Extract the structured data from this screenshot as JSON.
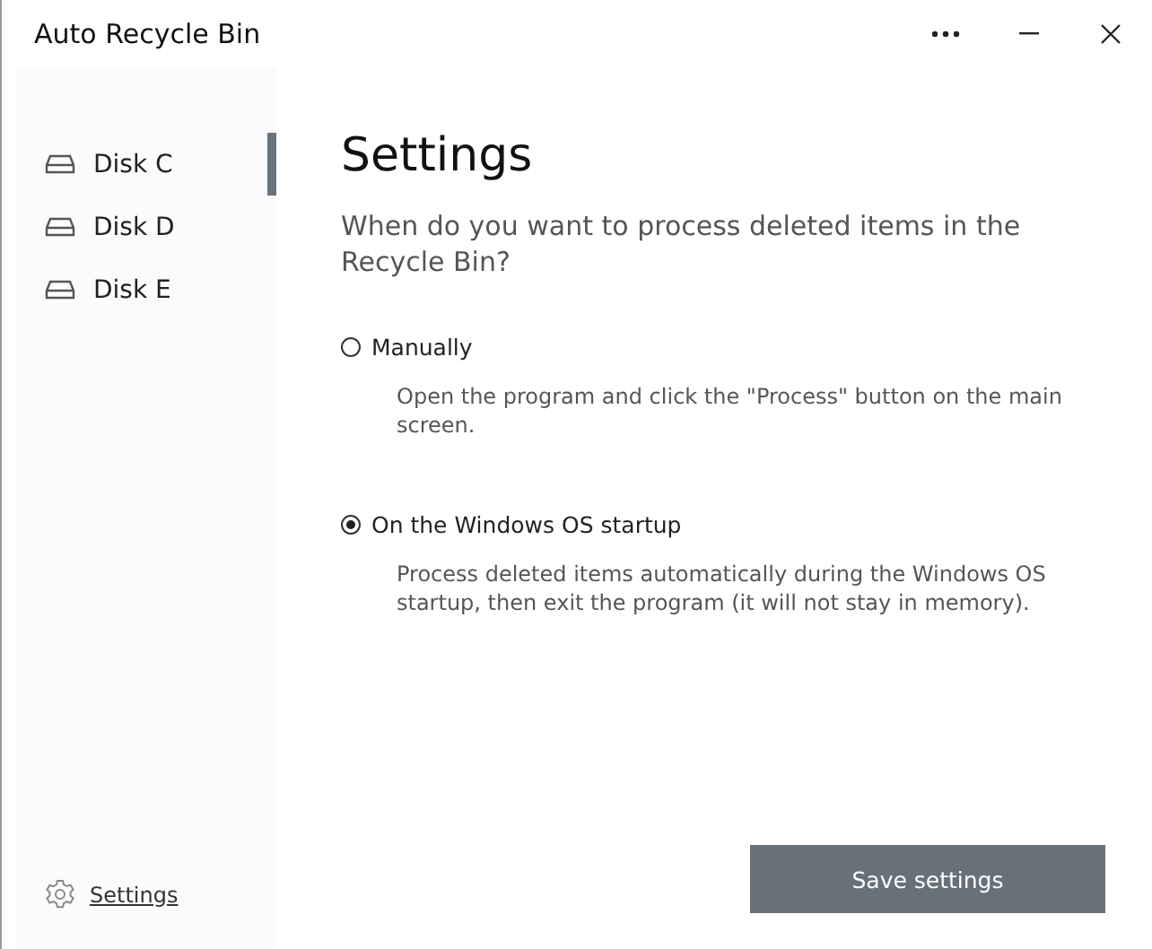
{
  "window": {
    "title": "Auto Recycle Bin"
  },
  "sidebar": {
    "items": [
      {
        "label": "Disk C",
        "selected": true
      },
      {
        "label": "Disk D",
        "selected": false
      },
      {
        "label": "Disk E",
        "selected": false
      }
    ],
    "settings_link": "Settings"
  },
  "content": {
    "heading": "Settings",
    "question": "When do you want to process deleted items in the Recycle Bin?",
    "options": [
      {
        "label": "Manually",
        "selected": false,
        "description": "Open the program and click the \"Process\" button on the main screen."
      },
      {
        "label": "On the Windows OS startup",
        "selected": true,
        "description": "Process deleted items automatically during the Windows OS startup, then exit the program (it will not stay in memory)."
      }
    ],
    "save_button": "Save settings"
  }
}
